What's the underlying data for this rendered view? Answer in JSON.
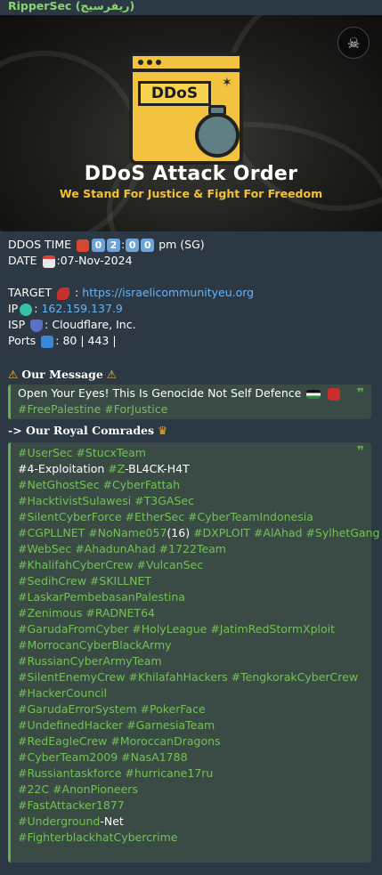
{
  "sender": {
    "name": "RipperSec (ريفرسيج)",
    "color": "#8ad46f"
  },
  "banner": {
    "box_text": "DDoS",
    "title": "DDoS Attack Order",
    "subtitle": "We Stand For Justice & Fight For Freedom",
    "logo_icon": "skull-logo-icon"
  },
  "info": {
    "ddos_time_label": "DDOS TIME",
    "ddos_time_digits": [
      "0",
      "2",
      "0",
      "0"
    ],
    "ddos_time_suffix": "pm (SG)",
    "date_label": "DATE",
    "date_value": ":07-Nov-2024",
    "target_label": "TARGET",
    "target_sep": ":",
    "target_url": "https://israelicommunityeu.org",
    "ip_label": "IP",
    "ip_sep": ":",
    "ip_value": "162.159.137.9",
    "isp_label": "ISP",
    "isp_value": ": Cloudflare, Inc.",
    "ports_label": "Ports",
    "ports_value": ": 80 | 443 |"
  },
  "message": {
    "heading": "Our Message",
    "text": "Open Your Eyes! This Is Genocide Not Self Defence",
    "tags": "#FreePalestine #ForJustice"
  },
  "comrades": {
    "heading": "-> Our Royal Comrades",
    "lines": [
      [
        {
          "t": "#UserSec #StucxTeam",
          "h": true
        }
      ],
      [
        {
          "t": "#4-Exploitation ",
          "h": false
        },
        {
          "t": "#Z",
          "h": true
        },
        {
          "t": "-BL4CK-H4T",
          "h": false
        }
      ],
      [
        {
          "t": "#NetGhostSec #CyberFattah",
          "h": true
        }
      ],
      [
        {
          "t": "#HacktivistSulawesi #T3GASec",
          "h": true
        }
      ],
      [
        {
          "t": "#SilentCyberForce #EtherSec #CyberTeamIndonesia",
          "h": true
        }
      ],
      [
        {
          "t": "#CGPLLNET #NoName057",
          "h": true
        },
        {
          "t": "(16) ",
          "h": false
        },
        {
          "t": "#DXPLOIT #AlAhad #SylhetGang",
          "h": true
        }
      ],
      [
        {
          "t": "#WebSec #AhadunAhad #1722Team",
          "h": true
        }
      ],
      [
        {
          "t": "#KhalifahCyberCrew #VulcanSec",
          "h": true
        }
      ],
      [
        {
          "t": "#SedihCrew #SKILLNET",
          "h": true
        }
      ],
      [
        {
          "t": "#LaskarPembebasanPalestina",
          "h": true
        }
      ],
      [
        {
          "t": "#Zenimous #RADNET64",
          "h": true
        }
      ],
      [
        {
          "t": "#GarudaFromCyber #HolyLeague  #JatimRedStormXploit",
          "h": true
        }
      ],
      [
        {
          "t": "#MorrocanCyberBlackArmy",
          "h": true
        }
      ],
      [
        {
          "t": "#RussianCyberArmyTeam",
          "h": true
        }
      ],
      [
        {
          "t": "#SilentEnemyCrew #KhilafahHackers #TengkorakCyberCrew",
          "h": true
        }
      ],
      [
        {
          "t": "#HackerCouncil",
          "h": true
        }
      ],
      [
        {
          "t": "#GarudaErrorSystem #PokerFace",
          "h": true
        }
      ],
      [
        {
          "t": "#UndefinedHacker #GarnesiaTeam",
          "h": true
        }
      ],
      [
        {
          "t": "#RedEagleCrew #MoroccanDragons",
          "h": true
        }
      ],
      [
        {
          "t": "#CyberTeam2009 #NasA1788",
          "h": true
        }
      ],
      [
        {
          "t": "#Russiantaskforce #hurricane17ru",
          "h": true
        }
      ],
      [
        {
          "t": "#22C #AnonPioneers",
          "h": true
        }
      ],
      [
        {
          "t": "#FastAttacker1877",
          "h": true
        }
      ],
      [
        {
          "t": "#Underground",
          "h": true
        },
        {
          "t": "-Net",
          "h": false
        }
      ],
      [
        {
          "t": "#FighterblackhatCybercrime",
          "h": true
        }
      ]
    ]
  },
  "colors": {
    "hashtag": "#75c158",
    "link": "#6ab3f3",
    "quote_bar": "#62b14d",
    "quote_bg": "#3a4a44"
  }
}
